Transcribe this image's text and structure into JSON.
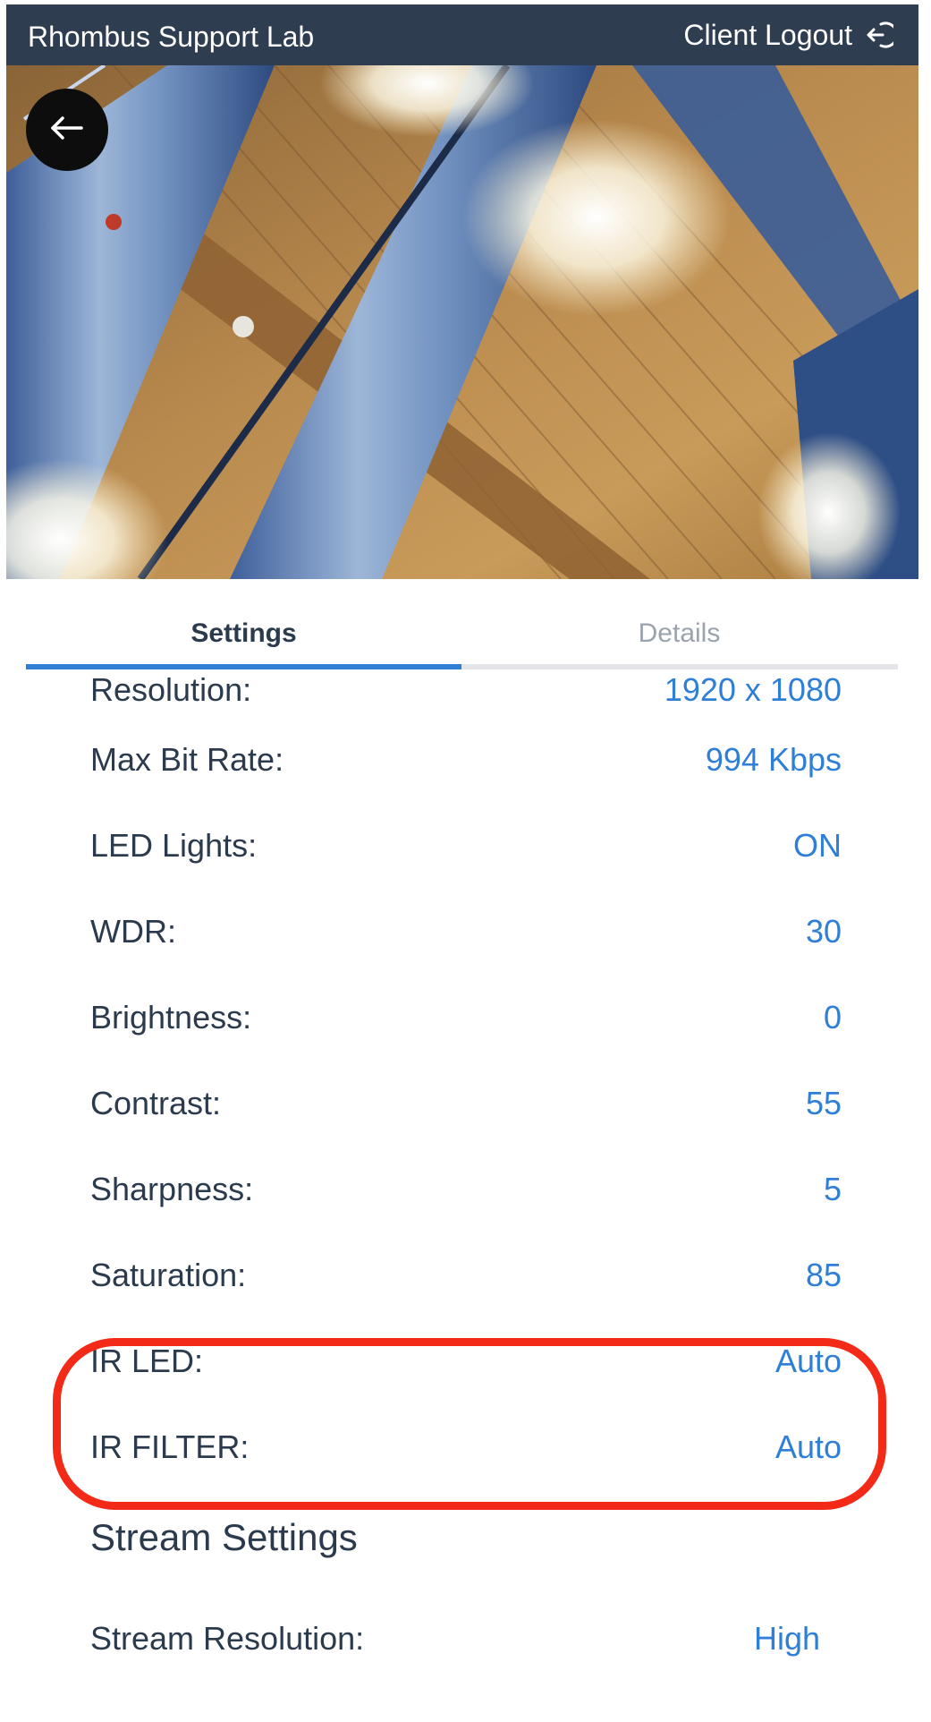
{
  "header": {
    "title": "Rhombus Support Lab",
    "logout_label": "Client Logout",
    "logout_icon": "logout-icon"
  },
  "camera": {
    "back_icon": "arrow-left-icon"
  },
  "tabs": [
    {
      "label": "Settings",
      "active": true
    },
    {
      "label": "Details",
      "active": false
    }
  ],
  "settings": {
    "rows": [
      {
        "label": "Resolution:",
        "value": "1920 x 1080"
      },
      {
        "label": "Max Bit Rate:",
        "value": "994 Kbps"
      },
      {
        "label": "LED Lights:",
        "value": "ON"
      },
      {
        "label": "WDR:",
        "value": "30"
      },
      {
        "label": "Brightness:",
        "value": "0"
      },
      {
        "label": "Contrast:",
        "value": "55"
      },
      {
        "label": "Sharpness:",
        "value": "5"
      },
      {
        "label": "Saturation:",
        "value": "85"
      },
      {
        "label": "IR LED:",
        "value": "Auto"
      },
      {
        "label": "IR FILTER:",
        "value": "Auto"
      }
    ],
    "stream_section_title": "Stream Settings",
    "stream_rows": [
      {
        "label": "Stream Resolution:",
        "value": "High"
      }
    ]
  },
  "colors": {
    "header_bg": "#2f3d51",
    "accent": "#2f7fd6",
    "highlight": "#f42a18"
  }
}
